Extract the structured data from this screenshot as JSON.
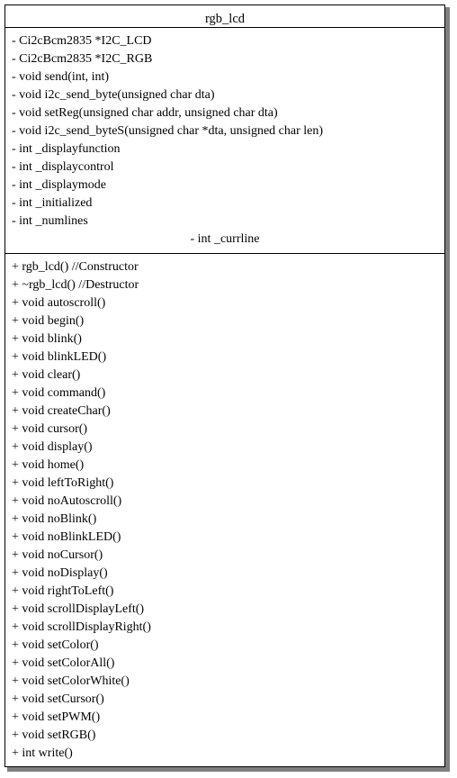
{
  "diagram": {
    "type": "uml-class-diagram",
    "class_name": "rgb_lcd",
    "colors": {
      "background": "#ffffff",
      "border": "#000000",
      "text": "#000000",
      "shadow": "#808080"
    },
    "attributes": [
      {
        "text": "- Ci2cBcm2835 *I2C_LCD",
        "visibility": "private",
        "align": "left"
      },
      {
        "text": "- Ci2cBcm2835 *I2C_RGB",
        "visibility": "private",
        "align": "left"
      },
      {
        "text": "- void send(int, int)",
        "visibility": "private",
        "align": "left"
      },
      {
        "text": "- void i2c_send_byte(unsigned char dta)",
        "visibility": "private",
        "align": "left"
      },
      {
        "text": "- void setReg(unsigned char addr, unsigned char dta)",
        "visibility": "private",
        "align": "left"
      },
      {
        "text": "- void i2c_send_byteS(unsigned char *dta, unsigned char len)",
        "visibility": "private",
        "align": "left"
      },
      {
        "text": "- int _displayfunction",
        "visibility": "private",
        "align": "left"
      },
      {
        "text": "- int _displaycontrol",
        "visibility": "private",
        "align": "left"
      },
      {
        "text": "- int _displaymode",
        "visibility": "private",
        "align": "left"
      },
      {
        "text": "- int _initialized",
        "visibility": "private",
        "align": "left"
      },
      {
        "text": "- int _numlines",
        "visibility": "private",
        "align": "left"
      },
      {
        "text": "- int _currline",
        "visibility": "private",
        "align": "center"
      }
    ],
    "methods": [
      {
        "text": "+ rgb_lcd() //Constructor",
        "visibility": "public",
        "align": "left"
      },
      {
        "text": "+ ~rgb_lcd() //Destructor",
        "visibility": "public",
        "align": "left"
      },
      {
        "text": "+ void autoscroll()",
        "visibility": "public",
        "align": "left"
      },
      {
        "text": "+ void begin()",
        "visibility": "public",
        "align": "left"
      },
      {
        "text": "+ void blink()",
        "visibility": "public",
        "align": "left"
      },
      {
        "text": "+ void blinkLED()",
        "visibility": "public",
        "align": "left"
      },
      {
        "text": "+ void clear()",
        "visibility": "public",
        "align": "left"
      },
      {
        "text": "+ void command()",
        "visibility": "public",
        "align": "left"
      },
      {
        "text": "+ void createChar()",
        "visibility": "public",
        "align": "left"
      },
      {
        "text": "+ void cursor()",
        "visibility": "public",
        "align": "left"
      },
      {
        "text": "+ void display()",
        "visibility": "public",
        "align": "left"
      },
      {
        "text": "+ void home()",
        "visibility": "public",
        "align": "left"
      },
      {
        "text": "+ void leftToRight()",
        "visibility": "public",
        "align": "left"
      },
      {
        "text": "+ void noAutoscroll()",
        "visibility": "public",
        "align": "left"
      },
      {
        "text": "+ void noBlink()",
        "visibility": "public",
        "align": "left"
      },
      {
        "text": "+ void noBlinkLED()",
        "visibility": "public",
        "align": "left"
      },
      {
        "text": "+ void noCursor()",
        "visibility": "public",
        "align": "left"
      },
      {
        "text": "+ void noDisplay()",
        "visibility": "public",
        "align": "left"
      },
      {
        "text": "+ void rightToLeft()",
        "visibility": "public",
        "align": "left"
      },
      {
        "text": "+ void scrollDisplayLeft()",
        "visibility": "public",
        "align": "left"
      },
      {
        "text": "+ void scrollDisplayRight()",
        "visibility": "public",
        "align": "left"
      },
      {
        "text": "+ void setColor()",
        "visibility": "public",
        "align": "left"
      },
      {
        "text": "+ void setColorAll()",
        "visibility": "public",
        "align": "left"
      },
      {
        "text": "+ void setColorWhite()",
        "visibility": "public",
        "align": "left"
      },
      {
        "text": "+ void setCursor()",
        "visibility": "public",
        "align": "left"
      },
      {
        "text": "+ void setPWM()",
        "visibility": "public",
        "align": "left"
      },
      {
        "text": "+ void setRGB()",
        "visibility": "public",
        "align": "left"
      },
      {
        "text": "+ int write()",
        "visibility": "public",
        "align": "left"
      }
    ]
  }
}
